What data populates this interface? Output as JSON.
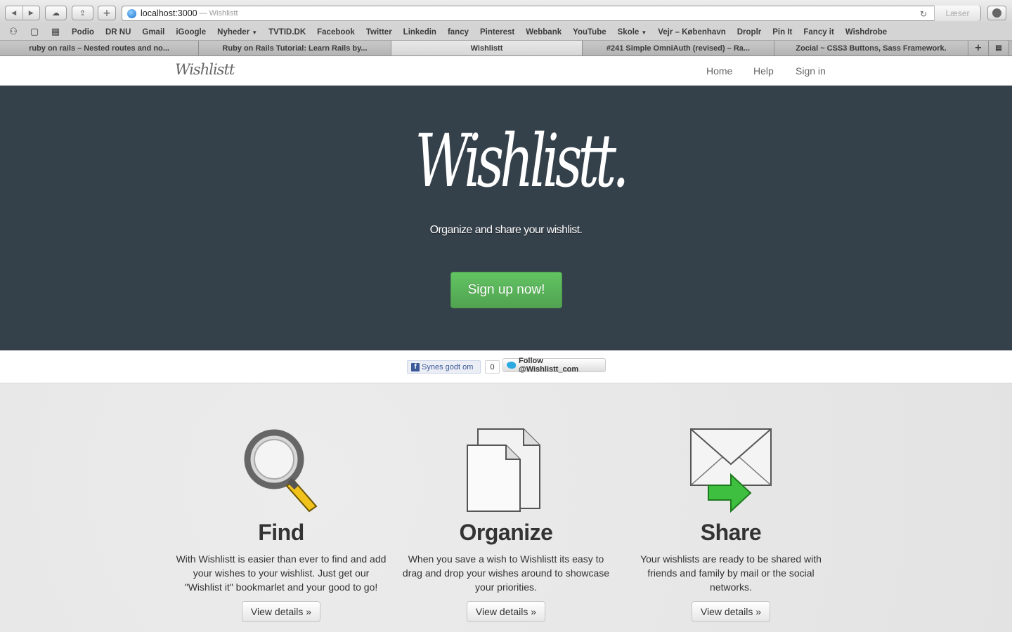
{
  "browser": {
    "url": "localhost:3000",
    "url_separator": "—",
    "page_title": "Wishlistt",
    "reader_label": "Læser",
    "bookmarks": [
      {
        "label": "Podio",
        "dropdown": false
      },
      {
        "label": "DR NU",
        "dropdown": false
      },
      {
        "label": "Gmail",
        "dropdown": false
      },
      {
        "label": "iGoogle",
        "dropdown": false
      },
      {
        "label": "Nyheder",
        "dropdown": true
      },
      {
        "label": "TVTID.DK",
        "dropdown": false
      },
      {
        "label": "Facebook",
        "dropdown": false
      },
      {
        "label": "Twitter",
        "dropdown": false
      },
      {
        "label": "Linkedin",
        "dropdown": false
      },
      {
        "label": "fancy",
        "dropdown": false
      },
      {
        "label": "Pinterest",
        "dropdown": false
      },
      {
        "label": "Webbank",
        "dropdown": false
      },
      {
        "label": "YouTube",
        "dropdown": false
      },
      {
        "label": "Skole",
        "dropdown": true
      },
      {
        "label": "Vejr – København",
        "dropdown": false
      },
      {
        "label": "Droplr",
        "dropdown": false
      },
      {
        "label": "Pin It",
        "dropdown": false
      },
      {
        "label": "Fancy it",
        "dropdown": false
      },
      {
        "label": "Wishdrobe",
        "dropdown": false
      }
    ],
    "tabs": [
      {
        "label": "ruby on rails – Nested routes and no...",
        "active": false
      },
      {
        "label": "Ruby on Rails Tutorial: Learn Rails by...",
        "active": false
      },
      {
        "label": "Wishlistt",
        "active": true
      },
      {
        "label": "#241 Simple OmniAuth (revised) – Ra...",
        "active": false
      },
      {
        "label": "Zocial ~ CSS3 Buttons, Sass Framework.",
        "active": false
      }
    ],
    "new_tab_label": "+"
  },
  "site": {
    "logo": "Wishlistt",
    "nav": {
      "home": "Home",
      "help": "Help",
      "signin": "Sign in"
    }
  },
  "hero": {
    "logo": "Wishlistt.",
    "tagline": "Organize and share your wishlist.",
    "cta": "Sign up now!",
    "background": "#34404a",
    "cta_color": "#5bb75b"
  },
  "social": {
    "fb_label": "Synes godt om",
    "fb_count": "0",
    "twitter_label": "Follow @Wishlistt_com"
  },
  "features": [
    {
      "title": "Find",
      "text": "With Wishlistt is easier than ever to find and add your wishes to your wishlist. Just get our \"Wishlist it\" bookmarlet and your good to go!",
      "button": "View details »",
      "icon": "magnifier-icon"
    },
    {
      "title": "Organize",
      "text": "When you save a wish to Wishlistt its easy to drag and drop your wishes around to showcase your priorities.",
      "button": "View details »",
      "icon": "documents-icon"
    },
    {
      "title": "Share",
      "text": "Your wishlists are ready to be shared with friends and family by mail or the social networks.",
      "button": "View details »",
      "icon": "envelope-arrow-icon"
    }
  ]
}
